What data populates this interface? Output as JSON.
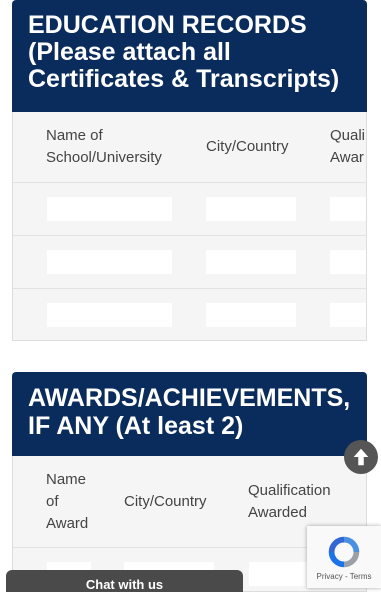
{
  "education": {
    "title_line1": "EDUCATION RECORDS",
    "title_line2": "(Please attach all",
    "title_line3": "Certificates & Transcripts)",
    "col1_line1": "Name of",
    "col1_line2": "School/University",
    "col2": "City/Country",
    "col3_line1": "Quali",
    "col3_line2": "Awar",
    "rows": 3
  },
  "awards": {
    "title_line1": "AWARDS/ACHIEVEMENTS,",
    "title_line2": "IF ANY (At least 2)",
    "col1_line1": "Name",
    "col1_line2": "of",
    "col1_line3": "Award",
    "col2": "City/Country",
    "col3_line1": "Qualification",
    "col3_line2": "Awarded"
  },
  "widgets": {
    "chat_label": "Chat with us",
    "recaptcha_links": "Privacy - Terms",
    "scroll_top_icon": "arrow-up-icon",
    "recaptcha_icon": "recaptcha-icon"
  }
}
